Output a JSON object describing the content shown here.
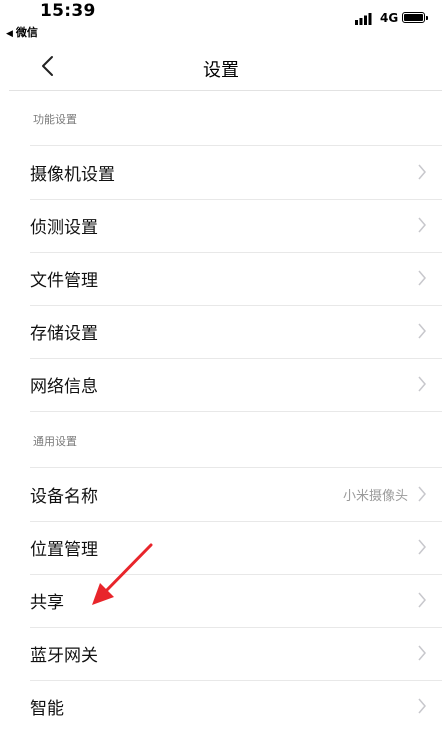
{
  "status_bar": {
    "time": "15:39",
    "back_app": "微信",
    "back_icon": "back-triangle-icon",
    "network": "4G",
    "signal_icon": "signal-icon",
    "battery_icon": "battery-icon"
  },
  "nav": {
    "title": "设置",
    "back_icon": "chevron-left-icon"
  },
  "sections": [
    {
      "header": "功能设置",
      "items": [
        {
          "label": "摄像机设置",
          "value": ""
        },
        {
          "label": "侦测设置",
          "value": ""
        },
        {
          "label": "文件管理",
          "value": ""
        },
        {
          "label": "存储设置",
          "value": ""
        },
        {
          "label": "网络信息",
          "value": ""
        }
      ]
    },
    {
      "header": "通用设置",
      "items": [
        {
          "label": "设备名称",
          "value": "小米摄像头"
        },
        {
          "label": "位置管理",
          "value": ""
        },
        {
          "label": "共享",
          "value": ""
        },
        {
          "label": "蓝牙网关",
          "value": ""
        },
        {
          "label": "智能",
          "value": ""
        }
      ]
    }
  ],
  "annotation": {
    "icon": "red-arrow-icon",
    "color": "#e8252b"
  },
  "colors": {
    "chevron": "#c7c7cc",
    "divider": "#e8e8e8",
    "section_header": "#7a7a7a",
    "value_text": "#9b9b9b"
  }
}
